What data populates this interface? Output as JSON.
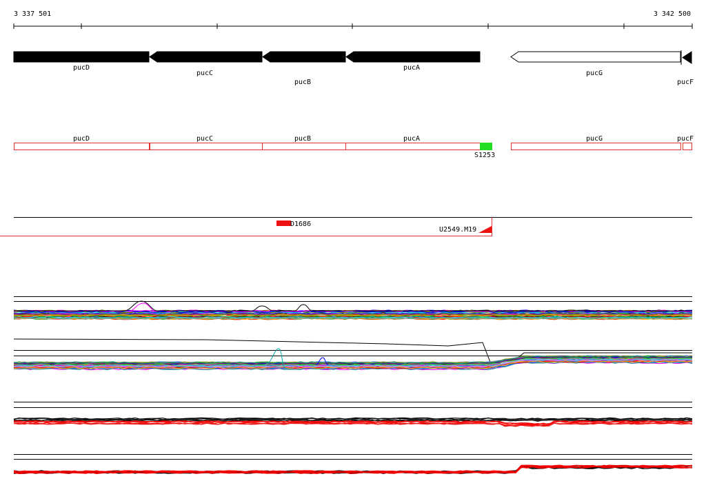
{
  "coords": {
    "start": "3 337 501",
    "end": "3 342 500"
  },
  "genes": [
    {
      "name": "pucD",
      "strand": "-",
      "filled": true,
      "from": 3337501,
      "to": 3338500
    },
    {
      "name": "pucC",
      "strand": "-",
      "filled": true,
      "from": 3338500,
      "to": 3339335
    },
    {
      "name": "pucB",
      "strand": "-",
      "filled": true,
      "from": 3339335,
      "to": 3339950
    },
    {
      "name": "pucA",
      "strand": "-",
      "filled": true,
      "from": 3339950,
      "to": 3340950
    },
    {
      "name": "pucG",
      "strand": "+",
      "filled": false,
      "from": 3341175,
      "to": 3342410
    },
    {
      "name": "pucF",
      "strand": "-",
      "filled": true,
      "from": 3342410,
      "to": 3342500
    }
  ],
  "gene_labels": [
    "pucD",
    "pucC",
    "pucB",
    "pucA",
    "pucG",
    "pucF"
  ],
  "annotation_labels": [
    "pucD",
    "pucC",
    "pucB",
    "pucA",
    "pucG",
    "pucF"
  ],
  "markers": {
    "green": "S1253",
    "red_small": "D1686",
    "segment_end": "U2549.M19"
  },
  "colors": {
    "gene_fill": "#000000",
    "annotation_box": "#e03030",
    "green_marker": "#22dd22",
    "red_marker": "#ee1111"
  },
  "series_palette": [
    "#000000",
    "#ff0000",
    "#0000ff",
    "#00aa00",
    "#ff00ff",
    "#00cccc",
    "#ffaa00",
    "#888800",
    "#880088",
    "#008888",
    "#aaaaff",
    "#66cc66",
    "#cc6600",
    "#999999",
    "#ff66aa",
    "#3366ff"
  ]
}
